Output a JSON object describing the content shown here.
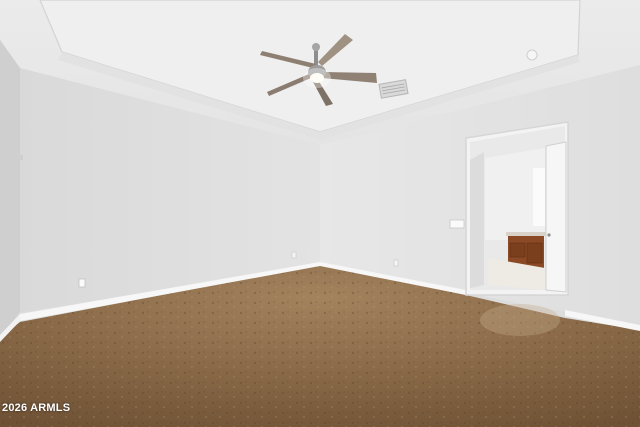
{
  "photo": {
    "subject": "empty-bedroom",
    "watermark": "2026 ARMLS",
    "colors": {
      "wall": "#e6e6e6",
      "ceiling": "#ececec",
      "floor": "#8a6a48",
      "cabinet": "#8b4a25"
    }
  }
}
